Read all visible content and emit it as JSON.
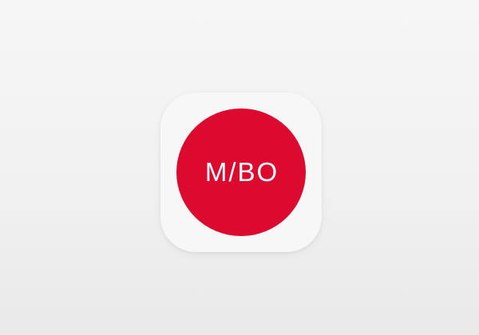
{
  "app_icon": {
    "logo_text": "M/BO",
    "colors": {
      "logo_circle": "#dd0a2f",
      "icon_tile": "#f7f7f8",
      "logo_text": "#ffffff",
      "background": "#f1f1f1"
    }
  }
}
